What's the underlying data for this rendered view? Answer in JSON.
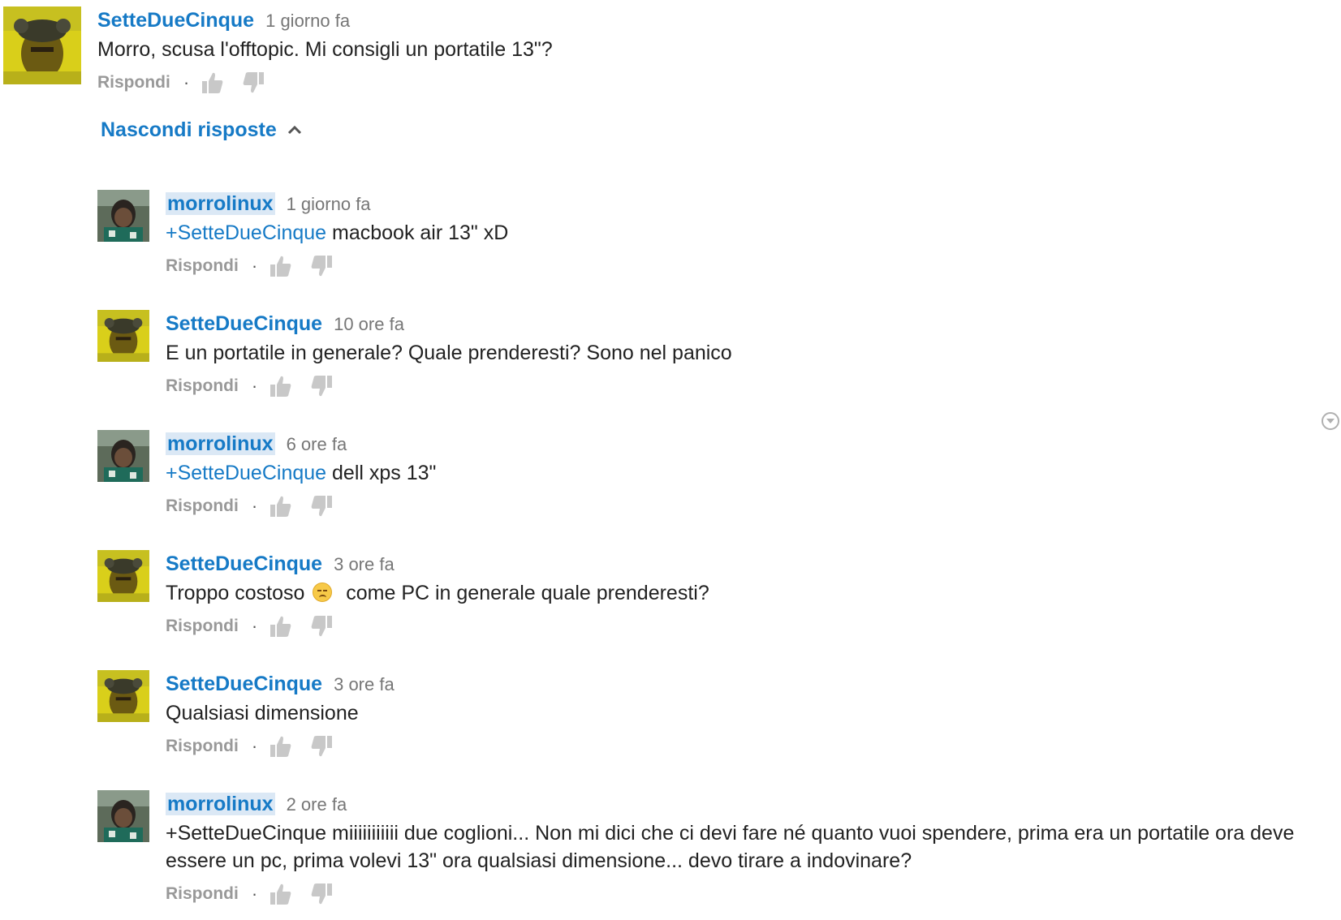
{
  "toggle_label": "Nascondi risposte",
  "colors": {
    "link": "#167ac6",
    "text": "#222222",
    "meta": "#767676",
    "action": "#999999"
  },
  "comments": [
    {
      "author": "SetteDueCinque",
      "time": "1 giorno fa",
      "owner": false,
      "mention": "",
      "text": "Morro, scusa l'offtopic. Mi consigli un portatile 13\"?",
      "text_after_emoji": "",
      "reply_label": "Rispondi",
      "avatar": "yellow-avatar"
    },
    {
      "author": "morrolinux",
      "time": "1 giorno fa",
      "owner": true,
      "mention": "+SetteDueCinque",
      "text": " macbook air 13\" xD",
      "text_after_emoji": "",
      "reply_label": "Rispondi",
      "avatar": "dark-avatar"
    },
    {
      "author": "SetteDueCinque",
      "time": "10 ore fa",
      "owner": false,
      "mention": "",
      "text": "E un portatile in generale? Quale prenderesti? Sono nel panico",
      "text_after_emoji": "",
      "reply_label": "Rispondi",
      "avatar": "yellow-avatar"
    },
    {
      "author": "morrolinux",
      "time": "6 ore fa",
      "owner": true,
      "mention": "+SetteDueCinque",
      "text": " dell xps 13\"",
      "text_after_emoji": "",
      "reply_label": "Rispondi",
      "avatar": "dark-avatar"
    },
    {
      "author": "SetteDueCinque",
      "time": "3 ore fa",
      "owner": false,
      "mention": "",
      "text": "Troppo costoso ",
      "text_after_emoji": "  come PC in generale quale prenderesti?",
      "reply_label": "Rispondi",
      "avatar": "yellow-avatar"
    },
    {
      "author": "SetteDueCinque",
      "time": "3 ore fa",
      "owner": false,
      "mention": "",
      "text": "Qualsiasi dimensione",
      "text_after_emoji": "",
      "reply_label": "Rispondi",
      "avatar": "yellow-avatar"
    },
    {
      "author": "morrolinux",
      "time": "2 ore fa",
      "owner": true,
      "mention": "",
      "text": "+SetteDueCinque miiiiiiiiiii due coglioni... Non mi dici che ci devi fare né quanto vuoi spendere, prima era un portatile ora deve essere un pc, prima volevi 13\" ora qualsiasi dimensione... devo tirare a indovinare?",
      "text_after_emoji": "",
      "reply_label": "Rispondi",
      "avatar": "dark-avatar"
    }
  ]
}
